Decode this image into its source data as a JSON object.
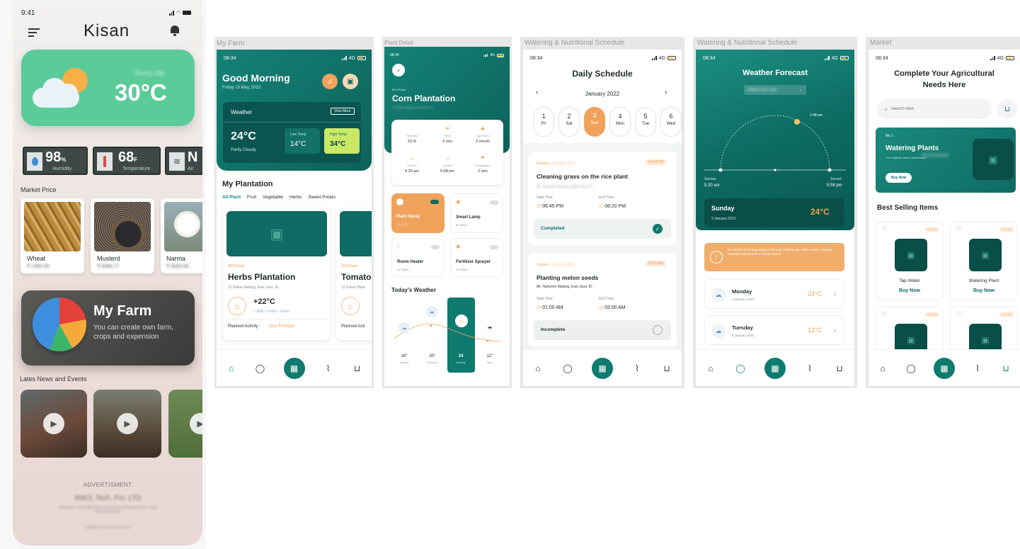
{
  "kisan": {
    "time": "9:41",
    "title": "Kisan",
    "weather": {
      "sub": "Sunny day",
      "temp": "30°C"
    },
    "stats": [
      {
        "value": "98",
        "unit": "%",
        "label": "Humidity"
      },
      {
        "value": "68",
        "unit": "F",
        "label": "Temperature"
      },
      {
        "value": "N",
        "unit": "",
        "label": "Air"
      }
    ],
    "market_title": "Market Price",
    "market": [
      {
        "name": "Wheat",
        "price": "₹ 1990.00"
      },
      {
        "name": "Musterd",
        "price": "₹ 5080.77"
      },
      {
        "name": "Narma",
        "price": "₹ 5000.00"
      }
    ],
    "farm_title": "My Farm",
    "farm_sub": "You can create own farm, crops and expension",
    "news_title": "Lates News and Events",
    "ad_label": "ADVERTISMENT",
    "ad_company": "SMCL Tech. Pvt. LTD",
    "ad_desc": "Software Development | Website Development | App Development",
    "ad_contact": "Contact Us 9876543210"
  },
  "myfarm": {
    "panel_label": "My Farm",
    "time": "08:34",
    "greeting": "Good Morning",
    "date": "Friday 13 May, 2022",
    "weather_label": "Weather",
    "view_more": "View More",
    "temp": "24°C",
    "cond": "Partly Cloudy",
    "low_label": "Low Temp",
    "low": "14°C",
    "high_label": "High Temp",
    "high": "34°C",
    "plant_title": "My Plantation",
    "filters": [
      "All Plant",
      "Fruit",
      "Vegetable",
      "Herbs",
      "Sweet Potato"
    ],
    "card1": {
      "count": "800 Plants",
      "name": "Herbs Plantation",
      "loc": "12 Sokun Malang, East Java, ID",
      "temp": "+22°C",
      "humid": "20%",
      "wind": "3 m/s",
      "rain": "0 mm",
      "activity_label": "Planned Activity :",
      "activity": "Give Fertilizer"
    },
    "card2": {
      "count": "400 Plants",
      "name": "Tomato",
      "loc": "12 Sokun Mala",
      "activity_label": "Planned Acti"
    }
  },
  "plant": {
    "panel_label": "Plant Detail",
    "time": "08:34",
    "count": "800 Plants",
    "name": "Corn Plantation",
    "loc": "12 Sokun Malang, East Java, ID",
    "stats": [
      {
        "label": "Humidity",
        "value": "20 %"
      },
      {
        "label": "Wind",
        "value": "5 m/s"
      },
      {
        "label": "Age Plant",
        "value": "2 month"
      },
      {
        "label": "Sunrise",
        "value": "5:20 am"
      },
      {
        "label": "Sunset",
        "value": "5:58 pm"
      },
      {
        "label": "Precipitation",
        "value": "2 mm"
      }
    ],
    "devices": [
      {
        "name": "Plant Spray",
        "sub": "5h 30min"
      },
      {
        "name": "Smart Lamp",
        "sub": "8h 30min"
      },
      {
        "name": "Room Heater",
        "sub": "5h 30min"
      },
      {
        "name": "Fertilizer Sprayer",
        "sub": "1h 30min"
      }
    ],
    "weather_title": "Today's Weather",
    "times": [
      {
        "t": "18°",
        "l": "Morning"
      },
      {
        "t": "30°",
        "l": "Afternoon"
      },
      {
        "t": "24",
        "l": "Evening"
      },
      {
        "t": "12°",
        "l": "Night"
      }
    ]
  },
  "schedule": {
    "panel_label": "Watering & Nutritional Schedule",
    "time": "08:34",
    "title": "Daily Schedule",
    "month": "January 2022",
    "days": [
      {
        "n": "1",
        "d": "Fri"
      },
      {
        "n": "2",
        "d": "Sat"
      },
      {
        "n": "3",
        "d": "Sun"
      },
      {
        "n": "4",
        "d": "Mon"
      },
      {
        "n": "5",
        "d": "Tue"
      },
      {
        "n": "6",
        "d": "Wed"
      }
    ],
    "tasks": [
      {
        "day": "Sunday,",
        "date": "3 January 2022",
        "time": "04:43 PM",
        "title": "Cleaning grass on the rice plant",
        "loc": "Mt. Hariyono Malang, East Java, ID",
        "start_label": "Start Time",
        "start": "06:45 PM",
        "end_label": "End Time",
        "end": "08:20 PM",
        "status": "Completed"
      },
      {
        "day": "Sunday,",
        "date": "3 January 2022",
        "time": "01:00 AM",
        "title": "Planting melon seeds",
        "loc": "Mt. Hariyono Malang, East Java, ID",
        "start_label": "Start Time",
        "start": "01:00 AM",
        "end_label": "End Time",
        "end": "03:00 AM",
        "status": "Incomplete"
      }
    ]
  },
  "forecast": {
    "panel_label": "Watering & Nutritional Schedule",
    "time": "08:34",
    "title": "Weather Forecast",
    "location": "Malang, East Java",
    "sun_time": "1:48 pm",
    "sunrise_label": "Sunrise",
    "sunrise": "5:20 am",
    "sunset_label": "Sunset",
    "sunset": "5:58 pm",
    "day": "Sunday",
    "date": "3 January 2022",
    "temp": "24°C",
    "alert": "Be careful at the beginning of this year extreme rain often occurs, causing landslides and floods in certain places",
    "list": [
      {
        "day": "Monday",
        "date": "4 January 2022",
        "temp": "24°C"
      },
      {
        "day": "Tuesday",
        "date": "5 January 2022",
        "temp": "12°C"
      }
    ]
  },
  "market": {
    "panel_label": "Market",
    "time": "08:34",
    "title": "Complete Your Agricultural Needs Here",
    "search_placeholder": "Search Item",
    "promo_no": "No 1",
    "promo_title": "Watering Plants",
    "promo_sub": "The material used is anti-shatter",
    "buy": "Buy Now",
    "best_title": "Best Selling Items",
    "items": [
      {
        "name": "Tap Water",
        "buy": "Buy Now"
      },
      {
        "name": "Watering Plant",
        "buy": "Buy Now"
      }
    ]
  },
  "colors": {
    "teal": "#0f6b63",
    "orange": "#f0a25b",
    "mint": "#5ccb9a",
    "lime": "#c9e866"
  }
}
